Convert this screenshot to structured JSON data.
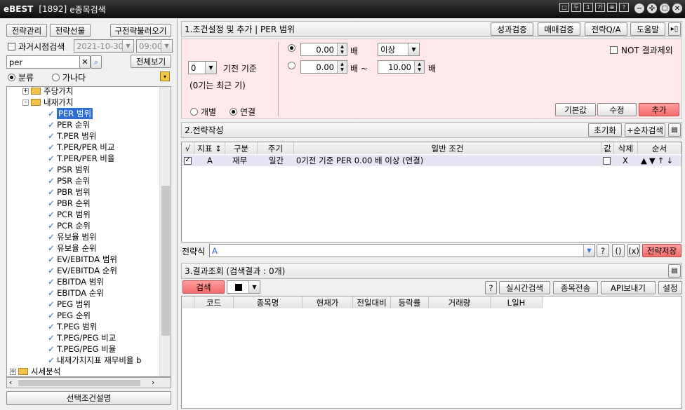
{
  "titlebar": {
    "logo": "eBEST",
    "window_id": "[1892]",
    "title": "e종목검색"
  },
  "left": {
    "btn_manage": "전략관리",
    "btn_select": "전략선물",
    "btn_load": "구전략불러오기",
    "past_search_label": "과거시점검색",
    "past_search_checked": false,
    "date_value": "2021-10-30",
    "time_value": "09:00",
    "search_value": "per",
    "btn_viewall": "전체보기",
    "radio_category": "분류",
    "radio_alpha": "가나다",
    "radio_selected": "분류",
    "tree": [
      {
        "label": "주당가치",
        "type": "folder",
        "state": "+"
      },
      {
        "label": "내재가치",
        "type": "folder",
        "state": "-"
      },
      {
        "label": "PER 범위",
        "type": "item",
        "selected": true
      },
      {
        "label": "PER 순위",
        "type": "item"
      },
      {
        "label": "T.PER 범위",
        "type": "item"
      },
      {
        "label": "T.PER/PER 비교",
        "type": "item"
      },
      {
        "label": "T.PER/PER 비율",
        "type": "item"
      },
      {
        "label": "PSR 범위",
        "type": "item"
      },
      {
        "label": "PSR 순위",
        "type": "item"
      },
      {
        "label": "PBR 범위",
        "type": "item"
      },
      {
        "label": "PBR 순위",
        "type": "item"
      },
      {
        "label": "PCR 범위",
        "type": "item"
      },
      {
        "label": "PCR 순위",
        "type": "item"
      },
      {
        "label": "유보율 범위",
        "type": "item"
      },
      {
        "label": "유보율 순위",
        "type": "item"
      },
      {
        "label": "EV/EBITDA 범위",
        "type": "item"
      },
      {
        "label": "EV/EBITDA 순위",
        "type": "item"
      },
      {
        "label": "EBITDA 범위",
        "type": "item"
      },
      {
        "label": "EBITDA 순위",
        "type": "item"
      },
      {
        "label": "PEG 범위",
        "type": "item"
      },
      {
        "label": "PEG 순위",
        "type": "item"
      },
      {
        "label": "T.PEG 범위",
        "type": "item"
      },
      {
        "label": "T.PEG/PEG 비교",
        "type": "item"
      },
      {
        "label": "T.PEG/PEG 비율",
        "type": "item"
      },
      {
        "label": "내재가치지표 재무비율 b",
        "type": "item"
      },
      {
        "label": "시세분석",
        "type": "folder",
        "state": "+"
      }
    ],
    "btn_desc": "선택조건설명"
  },
  "cond": {
    "title": "1.조건설정 및 추가  |  PER 범위",
    "btn_perf": "성과검증",
    "btn_trade": "매매검증",
    "btn_qa": "전략Q/A",
    "btn_help": "도움말",
    "period_value": "0",
    "period_label": "기전 기준",
    "period_note": "(0기는 최근 기)",
    "val1": "0.00",
    "unit1": "배",
    "op_value": "이상",
    "val2": "0.00",
    "unit2": "배 ~",
    "val3": "10.00",
    "unit3": "배",
    "not_exclude_label": "NOT 결과제외",
    "radio_individual": "개별",
    "radio_consolidated": "연결",
    "selected_scope": "연결",
    "btn_default": "기본값",
    "btn_modify": "수정",
    "btn_add": "추가"
  },
  "strategy": {
    "title": "2.전략작성",
    "btn_reset": "초기화",
    "btn_seq": "+순차검색",
    "headers": [
      "√",
      "지표 ↕",
      "구분",
      "주기",
      "일반 조건",
      "값",
      "삭제",
      "순서"
    ],
    "rows": [
      {
        "index": "A",
        "cat": "재무",
        "cycle": "일간",
        "cond": "0기전 기준 PER 0.00 배 이상 (연결)",
        "delete": "X",
        "order": "▲▼↑↓"
      }
    ],
    "formula_label": "전략식",
    "formula_value": "A",
    "btn_save": "전략저장"
  },
  "results": {
    "title": "3.결과조회 (검색결과 : 0개)",
    "btn_search": "검색",
    "btn_realtime": "실시간검색",
    "btn_send": "종목전송",
    "btn_api": "API보내기",
    "btn_settings": "설정",
    "headers": [
      "코드",
      "종목명",
      "현재가",
      "전일대비",
      "등락률",
      "거래량",
      "L일H"
    ]
  },
  "colors": {
    "accent_pink": "#ffe8ea",
    "selection": "#e8e4f4",
    "red_btn": "#f26b6b"
  }
}
